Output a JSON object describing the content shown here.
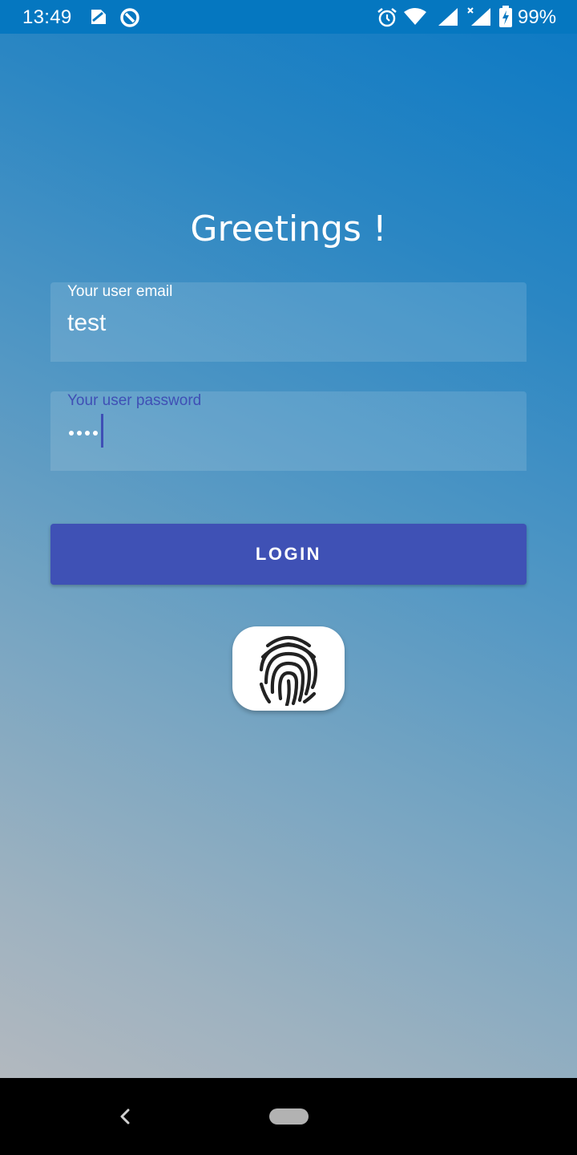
{
  "status_bar": {
    "time": "13:49",
    "battery_percent": "99%",
    "icons": [
      "sim-card-icon",
      "data-saver-icon",
      "alarm-icon",
      "wifi-icon",
      "signal-icon",
      "signal-no-data-icon",
      "battery-charging-icon"
    ]
  },
  "login": {
    "greeting": "Greetings !",
    "email": {
      "label": "Your user email",
      "value": "test"
    },
    "password": {
      "label": "Your user password",
      "masked_value": "••••"
    },
    "login_button_label": "LOGIN",
    "fingerprint_icon": "fingerprint-icon"
  },
  "colors": {
    "status_bar": "#0577c0",
    "accent": "#3f51b5",
    "background_top": "#0b79c4",
    "background_bottom": "#bbbbbe"
  },
  "nav_bar": {
    "icons": [
      "back-icon",
      "home-pill-icon"
    ]
  }
}
